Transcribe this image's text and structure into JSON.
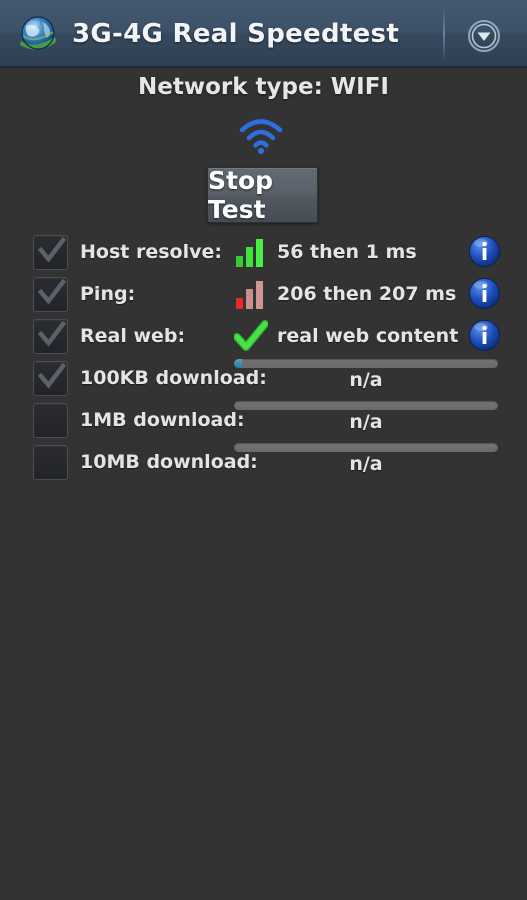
{
  "titlebar": {
    "logo_icon": "globe-icon",
    "title": "3G-4G Real Speedtest",
    "overflow_icon": "chevron-down-circle-icon"
  },
  "main": {
    "network_type": "Network type: WIFI",
    "connection_icon": "wifi-icon",
    "action_button": "Stop Test",
    "colors": {
      "header": "#3c5167",
      "background": "#333333",
      "accent_blue": "#1f56b0",
      "signal_good": "#3cdd3c",
      "signal_bad": "#e03030",
      "progress_fill": "#3a8fae",
      "button": "#5a6169"
    },
    "tests": [
      {
        "checked": true,
        "label": "Host resolve:",
        "icon": "signal-bars-green-icon",
        "value": "56 then 1 ms",
        "info_icon": "info-icon"
      },
      {
        "checked": true,
        "label": "Ping:",
        "icon": "signal-bars-red-icon",
        "value": "206 then 207 ms",
        "info_icon": "info-icon"
      },
      {
        "checked": true,
        "label": "Real web:",
        "icon": "green-check-icon",
        "value": "real web content",
        "info_icon": "info-icon"
      }
    ],
    "downloads": [
      {
        "checked": true,
        "label": "100KB download:",
        "progress": 3,
        "status": "n/a"
      },
      {
        "checked": false,
        "label": "1MB download:",
        "progress": 0,
        "status": "n/a"
      },
      {
        "checked": false,
        "label": "10MB download:",
        "progress": 0,
        "status": "n/a"
      }
    ]
  }
}
